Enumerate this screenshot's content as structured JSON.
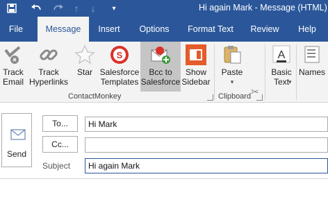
{
  "window": {
    "title": "Hi again Mark  -  Message (HTML)",
    "accent": "#2b579a",
    "qat_icons": [
      "save-icon",
      "undo-icon",
      "redo-icon",
      "up-arrow-icon",
      "down-arrow-icon",
      "customize-icon"
    ]
  },
  "tabs": [
    {
      "label": "File"
    },
    {
      "label": "Message",
      "active": true
    },
    {
      "label": "Insert"
    },
    {
      "label": "Options"
    },
    {
      "label": "Format Text"
    },
    {
      "label": "Review"
    },
    {
      "label": "Help"
    }
  ],
  "ribbon": {
    "contactmonkey": {
      "label": "ContactMonkey",
      "buttons": [
        {
          "label": "Track\nEmail",
          "icon": "track-email-icon"
        },
        {
          "label": "Track\nHyperlinks",
          "icon": "track-hyperlinks-icon"
        },
        {
          "label": "Star",
          "icon": "star-icon"
        },
        {
          "label": "Salesforce\nTemplates",
          "icon": "salesforce-templates-icon"
        },
        {
          "label": "Bcc to\nSalesforce",
          "icon": "bcc-salesforce-icon",
          "selected": true
        },
        {
          "label": "Show\nSidebar",
          "icon": "show-sidebar-icon"
        }
      ]
    },
    "clipboard": {
      "label": "Clipboard",
      "paste_label": "Paste"
    },
    "basic_text": {
      "label": "Basic\nText"
    },
    "names": {
      "label": "Names"
    }
  },
  "compose": {
    "send_label": "Send",
    "to_button": "To...",
    "cc_button": "Cc...",
    "subject_label": "Subject",
    "to_value": "Hi Mark",
    "cc_value": "",
    "subject_value": "Hi again Mark"
  }
}
